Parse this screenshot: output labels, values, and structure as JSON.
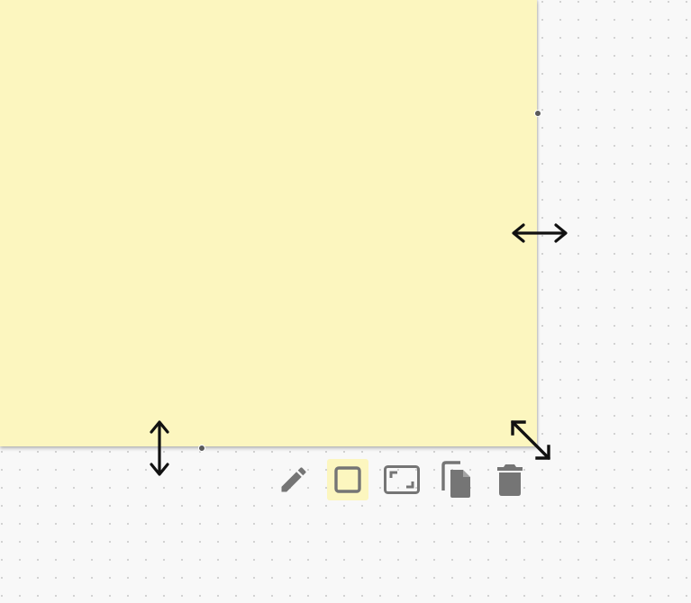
{
  "canvas": {
    "background_color": "#f8f8f8",
    "grid": "dotted"
  },
  "sticky_note": {
    "color": "#fcf6bf",
    "text": ""
  },
  "resize_handles": [
    {
      "name": "resize-horizontal-handle",
      "icon": "arrows-horizontal-icon"
    },
    {
      "name": "resize-vertical-handle",
      "icon": "arrows-vertical-icon"
    },
    {
      "name": "resize-diagonal-handle",
      "icon": "arrows-diagonal-icon"
    }
  ],
  "toolbar": {
    "tools": [
      {
        "name": "edit",
        "icon": "pencil-icon"
      },
      {
        "name": "shape",
        "icon": "square-icon",
        "selected": true
      },
      {
        "name": "fit-to-frame",
        "icon": "frame-icon"
      },
      {
        "name": "duplicate",
        "icon": "copy-icon"
      },
      {
        "name": "delete",
        "icon": "trash-icon"
      }
    ],
    "icon_color": "#757575",
    "selected_background": "#fcf6bf"
  }
}
